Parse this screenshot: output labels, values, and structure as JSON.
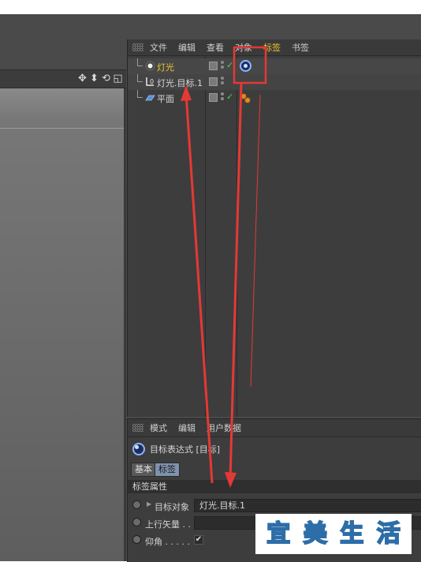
{
  "object_manager": {
    "menu": [
      "文件",
      "编辑",
      "查看",
      "对象",
      "标签",
      "书签"
    ],
    "active_menu_index": 4,
    "objects": [
      {
        "name": "灯光",
        "icon": "light-icon",
        "selected": true,
        "has_check": true,
        "tag": "target-tag-icon"
      },
      {
        "name": "灯光.目标.1",
        "icon": "null-object-icon",
        "selected": false,
        "has_check": false,
        "tag": ""
      },
      {
        "name": "平面",
        "icon": "plane-icon",
        "selected": false,
        "has_check": true,
        "tag": "material-tag-icon"
      }
    ]
  },
  "viewport": {
    "icons": [
      "move-view-icon",
      "zoom-view-icon",
      "rotate-view-icon",
      "maximize-view-icon"
    ],
    "icon_glyphs": [
      "✥",
      "⬍",
      "⟲",
      "◱"
    ]
  },
  "attribute_manager": {
    "menu": [
      "模式",
      "编辑",
      "用户数据"
    ],
    "title": "目标表达式 [目标]",
    "tabs": [
      "基本",
      "标签"
    ],
    "active_tab_index": 1,
    "section_title": "标签属性",
    "properties": [
      {
        "label": "目标对象",
        "value": "灯光.目标.1"
      },
      {
        "label": "上行矢量 . .",
        "value": ""
      },
      {
        "label": "仰角 . . . . .",
        "value": "✔"
      }
    ]
  },
  "watermark": {
    "chars": [
      "宜",
      "美",
      "生",
      "活"
    ],
    "colors": [
      "#2e86d6",
      "#57c43a",
      "#f2b81d",
      "#e2483c"
    ]
  },
  "colors": {
    "accent_menu": "#f2c530",
    "annotation_red": "#e53935"
  }
}
